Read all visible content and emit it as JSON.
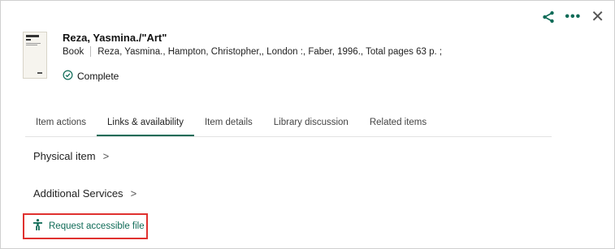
{
  "header": {
    "title": "Reza, Yasmina./\"Art\"",
    "format": "Book",
    "citation": "Reza, Yasmina., Hampton, Christopher,, London :, Faber, 1996., Total pages 63 p. ;",
    "status": "Complete"
  },
  "top_actions": {
    "share_icon": "share-icon",
    "more_icon": "more-icon",
    "more_glyph": "•••",
    "close_icon": "close-icon",
    "close_glyph": "✕"
  },
  "tabs": [
    {
      "label": "Item actions"
    },
    {
      "label": "Links & availability",
      "active": true
    },
    {
      "label": "Item details"
    },
    {
      "label": "Library discussion"
    },
    {
      "label": "Related items"
    }
  ],
  "sections": {
    "physical_item": "Physical item",
    "additional_services": "Additional Services",
    "chevron": ">"
  },
  "request": {
    "label": "Request accessible file",
    "icon": "accessibility-icon"
  },
  "colors": {
    "accent": "#0f6b57",
    "highlight_border": "#e0312f"
  }
}
